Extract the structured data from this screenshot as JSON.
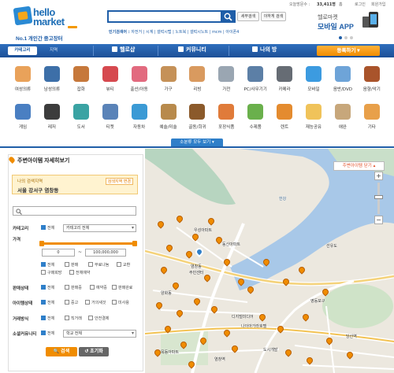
{
  "top_bar": {
    "visitors_label": "오늘방문수 :",
    "visitors_count": "33,411명",
    "home": "홈",
    "login": "로그인",
    "join": "회원가입"
  },
  "logo": {
    "word1": "hello",
    "word2": "market",
    "tagline": "No.1 개인간 중고장터"
  },
  "search": {
    "placeholder": "",
    "detail_btn": "세부검색",
    "in_result_btn": "이하게 검색"
  },
  "popular": {
    "label": "인기검색어 :",
    "items": [
      "자전거",
      "시계",
      "갤럭시탭",
      "노트북",
      "갤럭시노트",
      "mcm",
      "아이폰4"
    ]
  },
  "promo": {
    "line1": "헬로마켓",
    "line2": "모바일 APP"
  },
  "nav": {
    "category": "카테고리",
    "region": "지역",
    "hellosang": "헬로샵",
    "community": "커뮤니티",
    "myroom": "나의 방",
    "register": "등록하기"
  },
  "categories": [
    {
      "label": "여성의류",
      "color": "#e9a25a"
    },
    {
      "label": "남성의류",
      "color": "#3d6fa8"
    },
    {
      "label": "잡화",
      "color": "#c6783b"
    },
    {
      "label": "뷰티",
      "color": "#d6494f"
    },
    {
      "label": "출산/아동",
      "color": "#e26a7f"
    },
    {
      "label": "가구",
      "color": "#c59158"
    },
    {
      "label": "리빙",
      "color": "#d99a5f"
    },
    {
      "label": "가전",
      "color": "#9aa6b2"
    },
    {
      "label": "PC/사무기기",
      "color": "#5c7fa6"
    },
    {
      "label": "카메라",
      "color": "#666c74"
    },
    {
      "label": "모바일",
      "color": "#3c9be0"
    },
    {
      "label": "음반/DVD",
      "color": "#6ea4d8"
    },
    {
      "label": "음향/악기",
      "color": "#a9542b"
    },
    {
      "label": "게임",
      "color": "#4a7fc2"
    },
    {
      "label": "레저",
      "color": "#3c3c3c"
    },
    {
      "label": "도서",
      "color": "#3aa3a3"
    },
    {
      "label": "티켓",
      "color": "#5a83b8"
    },
    {
      "label": "자동차",
      "color": "#3b9ad5"
    },
    {
      "label": "예술/미술",
      "color": "#b88a4c"
    },
    {
      "label": "골동/희귀",
      "color": "#8b5a2b"
    },
    {
      "label": "포장식품",
      "color": "#e07b3a"
    },
    {
      "label": "수제품",
      "color": "#6ab04c"
    },
    {
      "label": "렌트",
      "color": "#e48b2f"
    },
    {
      "label": "재능공유",
      "color": "#f0c35a"
    },
    {
      "label": "애완",
      "color": "#c7a77b"
    },
    {
      "label": "기타",
      "color": "#e8a04a"
    }
  ],
  "more_btn": "소분류 모두 보기",
  "panel": {
    "title": "주변아이템 자세히보기",
    "region_label": "나의 검색지역",
    "region_value": "서울 강서구 염창동",
    "region_change": "검색지역 변경",
    "category_label": "카테고리",
    "all": "전체",
    "category_select": "카테고리 전체",
    "price_label": "가격",
    "price_min": "0",
    "price_max": "100,000,000",
    "price_sep": "~",
    "trade_opts": [
      "전체",
      "판매",
      "무료나눔",
      "교환",
      "구매희망",
      "경매"
    ],
    "trade_opts_row2": [
      "구매희망",
      "전체예약"
    ],
    "sale_label": "판매상태",
    "sale_opts": [
      "전체",
      "판매중",
      "예약중",
      "판매완료"
    ],
    "item_label": "아이템상태",
    "item_opts": [
      "전체",
      "중고",
      "거의새것",
      "미사용"
    ],
    "deal_label": "거래방식",
    "deal_opts": [
      "전체",
      "직거래",
      "안전결제"
    ],
    "seller_label": "소셜커뮤니티",
    "seller_select": "학교 전체",
    "search_btn": "검색",
    "reset_btn": "초기화"
  },
  "map": {
    "close": "주변아이템 닫기",
    "labels": [
      "우성아파트",
      "동신아파트",
      "염창동",
      "주민센터",
      "영등포구",
      "양화동",
      "한강",
      "디지털미디어",
      "목동아파트",
      "당산역",
      "선유도",
      "나이아가라호텔",
      "도시개발",
      "염창역"
    ]
  },
  "colors": {
    "brand_blue": "#1f5ea8",
    "accent_orange": "#f08c00"
  }
}
